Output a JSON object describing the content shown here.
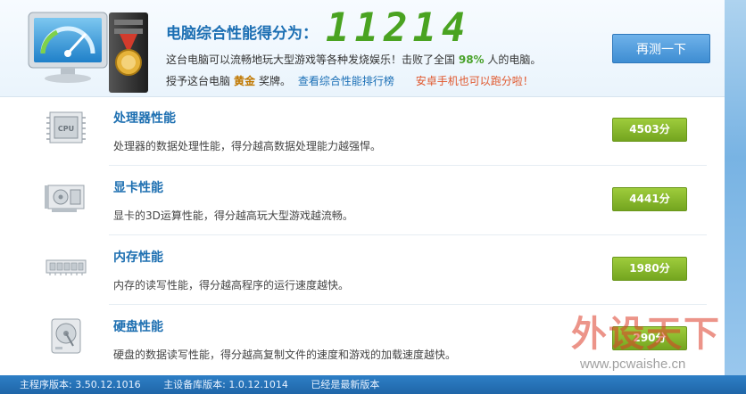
{
  "header": {
    "score_label": "电脑综合性能得分为：",
    "score": "11214",
    "summary_prefix": "这台电脑可以流畅地玩大型游戏等各种发烧娱乐！击败了全国",
    "summary_pct": "98%",
    "summary_suffix": "人的电脑。",
    "award_prefix": "授予这台电脑",
    "award_medal": "黄金",
    "award_suffix": "奖牌。",
    "rank_link": "查看综合性能排行榜",
    "android_link": "安卓手机也可以跑分啦！",
    "retest_label": "再测一下"
  },
  "rows": [
    {
      "title": "处理器性能",
      "desc": "处理器的数据处理性能，得分越高数据处理能力越强悍。",
      "score": "4503分",
      "icon": "cpu-icon"
    },
    {
      "title": "显卡性能",
      "desc": "显卡的3D运算性能，得分越高玩大型游戏越流畅。",
      "score": "4441分",
      "icon": "graphics-card-icon"
    },
    {
      "title": "内存性能",
      "desc": "内存的读写性能，得分越高程序的运行速度越快。",
      "score": "1980分",
      "icon": "memory-icon"
    },
    {
      "title": "硬盘性能",
      "desc": "硬盘的数据读写性能，得分越高复制文件的速度和游戏的加载速度越快。",
      "score": "290分",
      "icon": "hard-disk-icon"
    }
  ],
  "footer": {
    "main_version": "主程序版本: 3.50.12.1016",
    "db_version": "主设备库版本: 1.0.12.1014",
    "status": "已经是最新版本"
  },
  "watermark": {
    "brand": "外设天下",
    "url": "www.pcwaishe.cn"
  },
  "colors": {
    "accent_blue": "#1d6fb1",
    "score_green": "#4aa321",
    "badge_green": "#8bbd2e",
    "footer_blue": "#2471b5"
  }
}
